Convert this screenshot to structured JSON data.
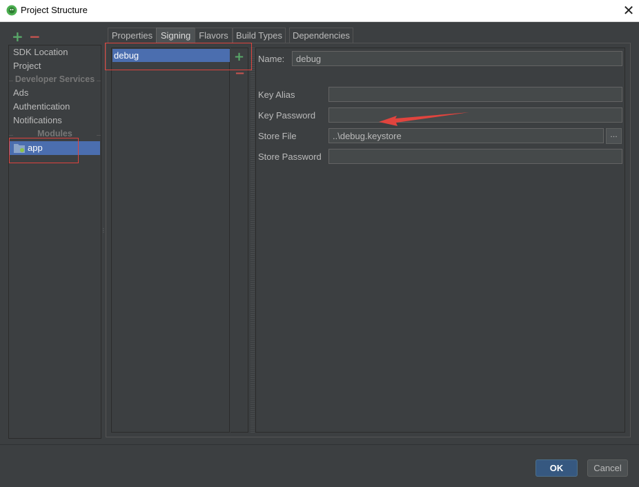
{
  "window": {
    "title": "Project Structure",
    "close_glyph": "✕"
  },
  "sidebar": {
    "add_glyph": "+",
    "remove_glyph": "−",
    "items": [
      "SDK Location",
      "Project"
    ],
    "developer_services_label": "Developer Services",
    "services": [
      "Ads",
      "Authentication",
      "Notifications"
    ],
    "modules_label": "Modules",
    "module": "app"
  },
  "tabs": [
    "Properties",
    "Signing",
    "Flavors",
    "Build Types",
    "Dependencies"
  ],
  "signing": {
    "configs": [
      "debug"
    ],
    "add_glyph": "+",
    "remove_glyph": "−"
  },
  "form": {
    "name_label": "Name:",
    "name_value": "debug",
    "key_alias_label": "Key Alias",
    "key_alias_value": "",
    "key_password_label": "Key Password",
    "key_password_value": "",
    "store_file_label": "Store File",
    "store_file_value": "..\\debug.keystore",
    "browse_glyph": "...",
    "store_password_label": "Store Password",
    "store_password_value": ""
  },
  "buttons": {
    "ok": "OK",
    "cancel": "Cancel"
  },
  "colors": {
    "selection": "#4b6eaf",
    "annotation": "#e0443e",
    "add": "#59a869",
    "remove": "#c75450"
  }
}
